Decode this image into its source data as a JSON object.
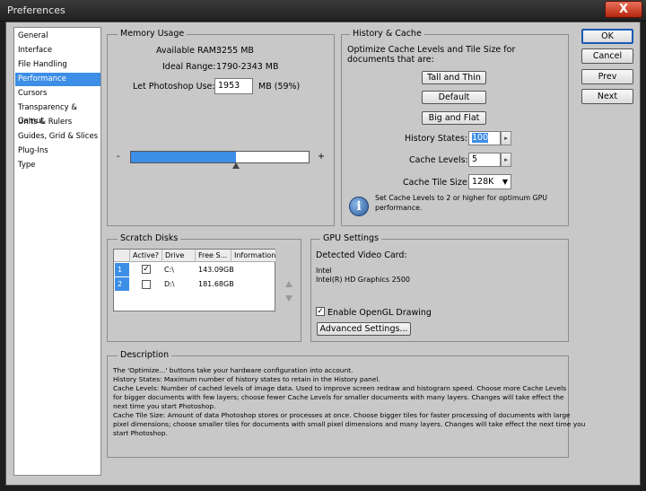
{
  "window": {
    "title": "Preferences",
    "close": "X"
  },
  "nav": {
    "items": [
      "General",
      "Interface",
      "File Handling",
      "Performance",
      "Cursors",
      "Transparency & Gamut",
      "Units & Rulers",
      "Guides, Grid & Slices",
      "Plug-Ins",
      "Type"
    ],
    "selected": "Performance"
  },
  "actions": {
    "ok": "OK",
    "cancel": "Cancel",
    "prev": "Prev",
    "next": "Next"
  },
  "memory": {
    "legend": "Memory Usage",
    "available_label": "Available RAM:",
    "available_value": "3255 MB",
    "ideal_label": "Ideal Range:",
    "ideal_value": "1790-2343 MB",
    "use_label": "Let Photoshop Use:",
    "use_value": "1953",
    "use_unit": "MB (59%)",
    "slider_fraction": 0.59,
    "minus": "-",
    "plus": "+"
  },
  "history": {
    "legend": "History & Cache",
    "intro_line1": "Optimize Cache Levels and Tile Size for",
    "intro_line2": "documents that are:",
    "btn_tall": "Tall and Thin",
    "btn_default": "Default",
    "btn_big": "Big and Flat",
    "states_label": "History States:",
    "states_value": "100",
    "levels_label": "Cache Levels:",
    "levels_value": "5",
    "tile_label": "Cache Tile Size:",
    "tile_value": "128K",
    "info_line1": "Set Cache Levels to 2 or higher for optimum GPU",
    "info_line2": "performance."
  },
  "scratch": {
    "legend": "Scratch Disks",
    "columns": [
      "Active?",
      "Drive",
      "Free S...",
      "Information"
    ],
    "rows": [
      {
        "num": "1",
        "active": true,
        "check": "✓",
        "drive": "C:\\",
        "free": "143.09GB"
      },
      {
        "num": "2",
        "active": false,
        "check": "",
        "drive": "D:\\",
        "free": "181.68GB"
      }
    ]
  },
  "gpu": {
    "legend": "GPU Settings",
    "detected_label": "Detected Video Card:",
    "vendor": "Intel",
    "model": "Intel(R) HD Graphics 2500",
    "opengl_label": "Enable OpenGL Drawing",
    "opengl_check": "✓",
    "advanced": "Advanced Settings..."
  },
  "description": {
    "legend": "Description",
    "lines": [
      "The 'Optimize...' buttons take your hardware configuration into account.",
      "History States: Maximum number of history states to retain in the History panel.",
      "Cache Levels: Number of cached levels of image data.  Used to improve screen redraw and histogram speed.  Choose more Cache Levels",
      "for bigger documents with few layers; choose fewer Cache Levels for smaller documents with many layers. Changes will take effect the",
      "next time you start Photoshop.",
      "Cache Tile Size: Amount of data Photoshop stores or processes at once. Choose bigger tiles for faster processing of documents with large",
      "pixel dimensions; choose smaller tiles for documents with small pixel dimensions and many layers. Changes will take effect the next time you",
      "start Photoshop."
    ]
  },
  "colors": {
    "accent": "#3d8ee6",
    "dialog_bg": "#c8c8c8",
    "titlebar": "#2a2a2a",
    "close": "#c8402a"
  }
}
